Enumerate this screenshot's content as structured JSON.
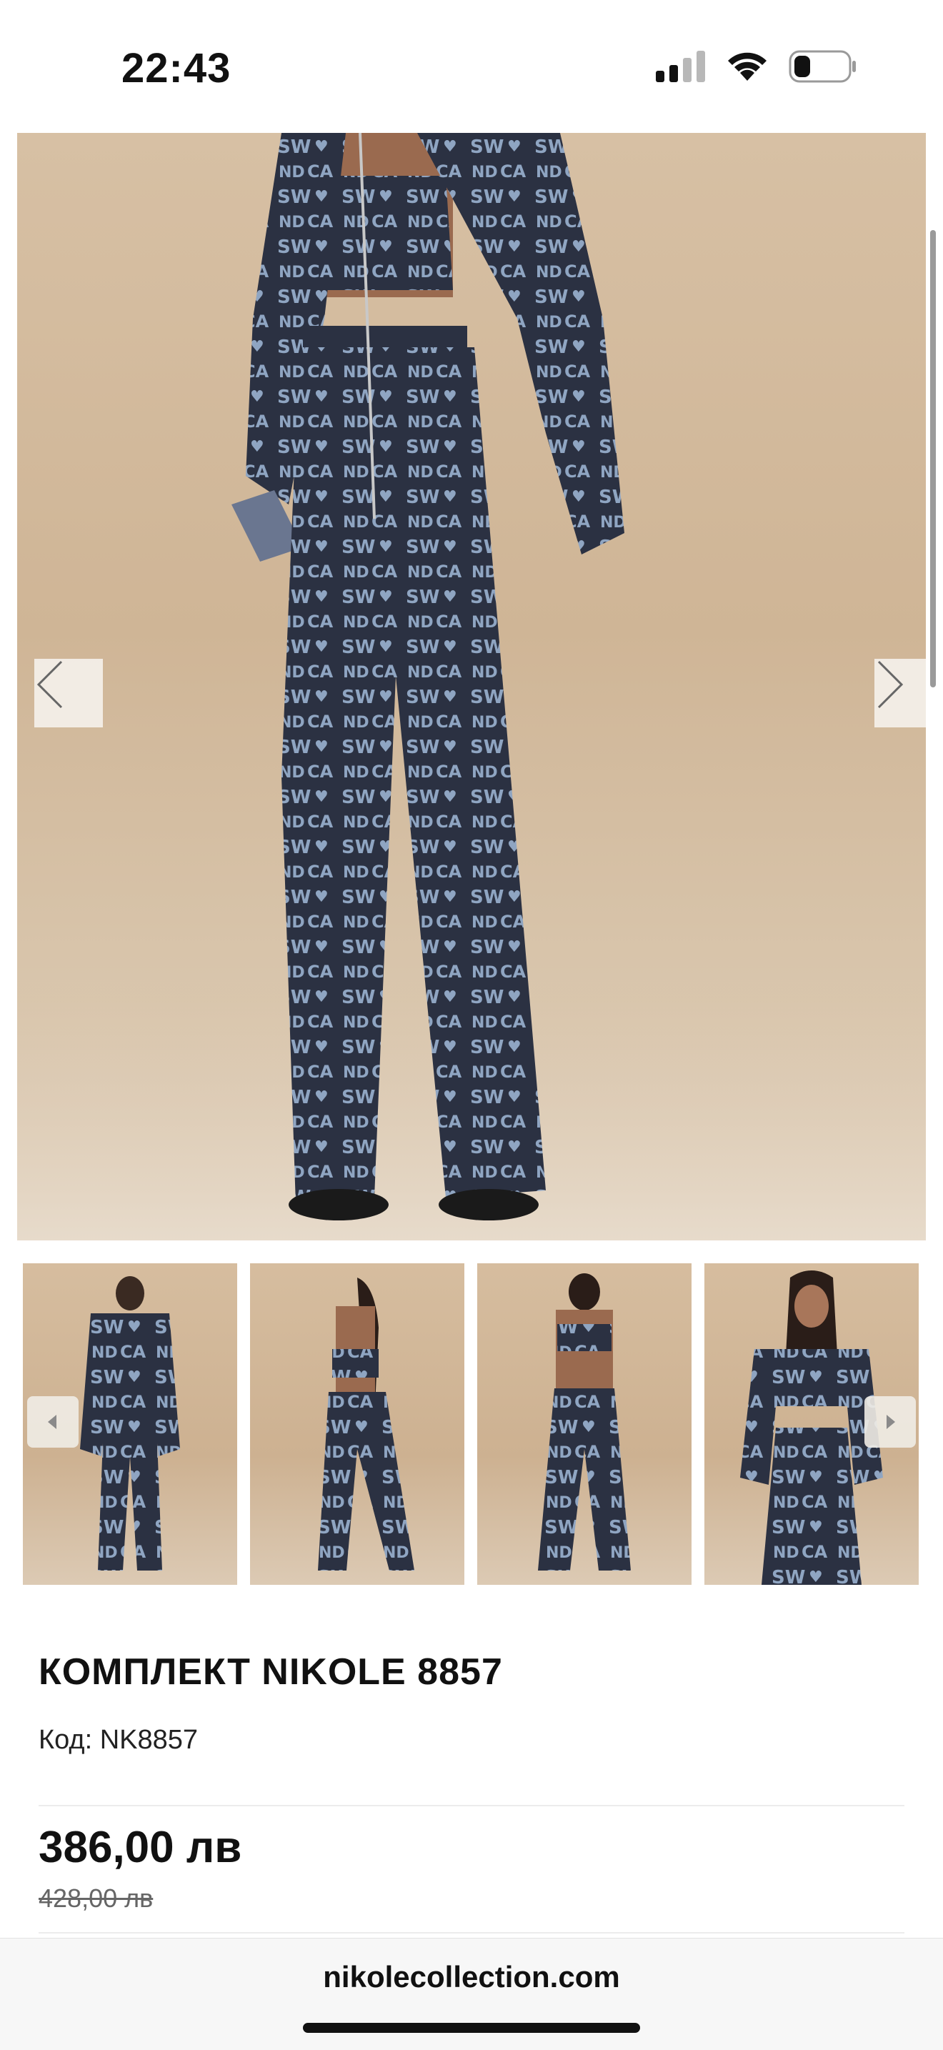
{
  "status_bar": {
    "time": "22:43",
    "battery_level": 0.25
  },
  "gallery": {
    "main_image_alt": "",
    "prev_icon": "chevron-left-icon",
    "next_icon": "chevron-right-icon",
    "thumbnail_count": 4
  },
  "product": {
    "title": "КОМПЛЕКТ NIKOLE 8857",
    "code": "Код: NK8857",
    "price_current": "386,00 лв",
    "price_old": "428,00 лв"
  },
  "browser": {
    "url": "nikolecollection.com"
  },
  "colors": {
    "background": "#ffffff",
    "backdrop": "#d2b99b",
    "denim": "#2b3142",
    "print": "#8fa5c2",
    "text": "#111111"
  }
}
